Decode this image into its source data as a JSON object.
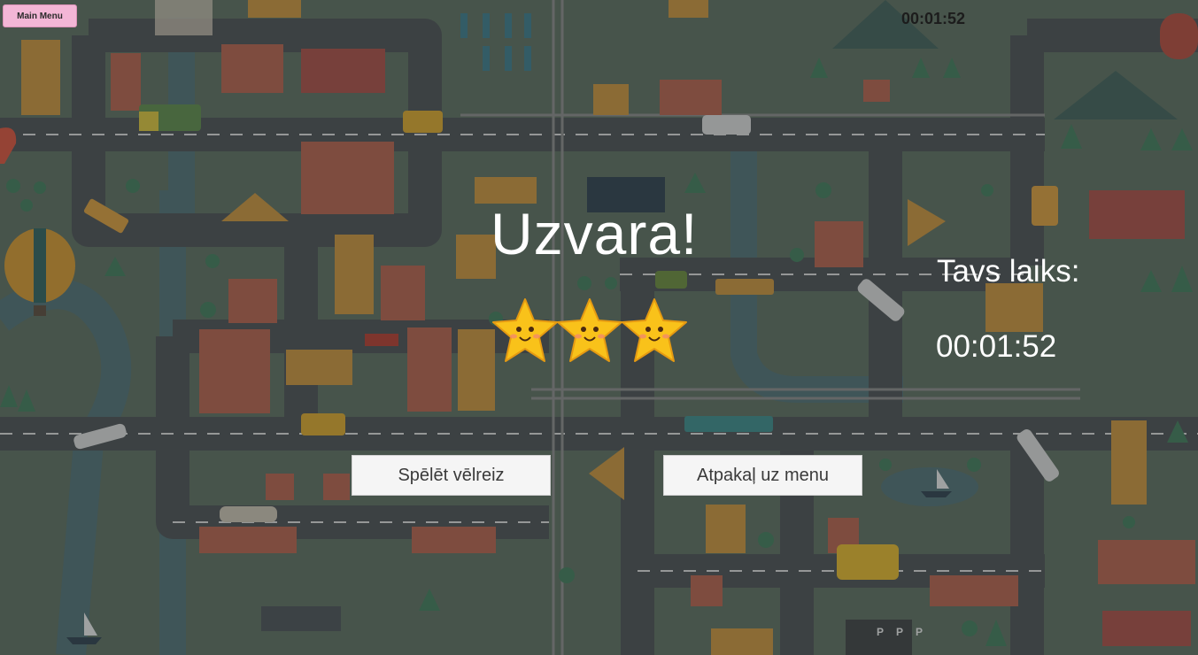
{
  "menu_button": {
    "label": "Main Menu"
  },
  "timer": {
    "top": "00:01:52"
  },
  "result": {
    "title": "Uzvara!",
    "stars_earned": 3,
    "stars_total": 3,
    "time_label": "Tavs laiks:",
    "time_value": "00:01:52"
  },
  "buttons": {
    "replay": "Spēlēt vēlreiz",
    "back_to_menu": "Atpakaļ uz menu"
  },
  "colors": {
    "star_fill": "#f9c21a",
    "overlay_text": "#ffffff",
    "menu_button_bg": "#f3b6d6"
  }
}
